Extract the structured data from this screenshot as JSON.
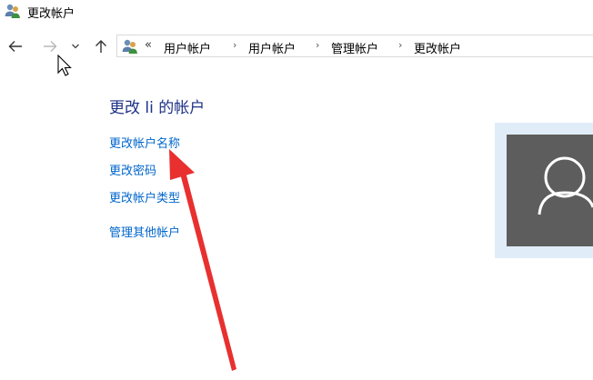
{
  "window": {
    "title": "更改帐户",
    "icon": "users-icon"
  },
  "nav": {
    "back_icon": "arrow-left-icon",
    "forward_icon": "arrow-right-icon",
    "recent_icon": "chevron-down-icon",
    "up_icon": "arrow-up-icon"
  },
  "address_bar": {
    "overflow_chevron": "«",
    "separator": "›",
    "breadcrumbs": [
      "用户帐户",
      "用户帐户",
      "管理帐户",
      "更改帐户"
    ]
  },
  "main": {
    "heading": "更改 li 的帐户",
    "links": {
      "change_name": "更改帐户名称",
      "change_password": "更改密码",
      "change_type": "更改帐户类型",
      "manage_other": "管理其他帐户"
    }
  },
  "colors": {
    "heading": "#1e3287",
    "link": "#0066cc",
    "avatar_bg": "#5d5d5d",
    "avatar_frame": "#e0edf9",
    "annotation_arrow": "#e8302f"
  }
}
